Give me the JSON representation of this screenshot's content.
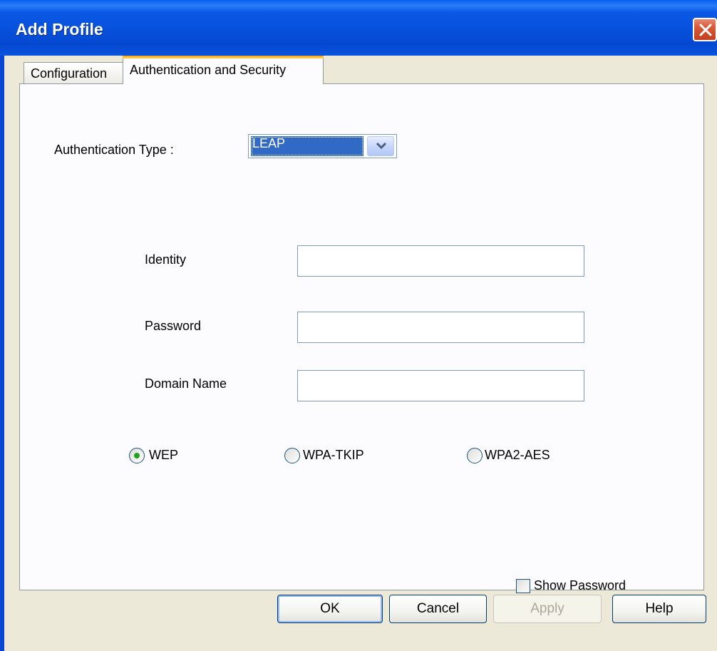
{
  "window": {
    "title": "Add Profile"
  },
  "tabs": [
    {
      "label": "Configuration",
      "active": false
    },
    {
      "label": "Authentication and Security",
      "active": true
    }
  ],
  "auth": {
    "type_label": "Authentication Type :",
    "type_value": "LEAP"
  },
  "fields": {
    "identity_label": "Identity",
    "identity_value": "",
    "password_label": "Password",
    "password_value": "",
    "domain_label": "Domain Name",
    "domain_value": ""
  },
  "encryption": {
    "options": [
      "WEP",
      "WPA-TKIP",
      "WPA2-AES"
    ],
    "selected": "WEP"
  },
  "show_password": {
    "label": "Show Password",
    "checked": false
  },
  "buttons": {
    "ok": "OK",
    "cancel": "Cancel",
    "apply": "Apply",
    "help": "Help"
  },
  "colors": {
    "title_bar": "#0a54dd",
    "face": "#ece9d8",
    "selection": "#316ac5",
    "close": "#d9583a"
  },
  "icons": {
    "close": "close-icon",
    "dropdown": "chevron-down-icon"
  }
}
